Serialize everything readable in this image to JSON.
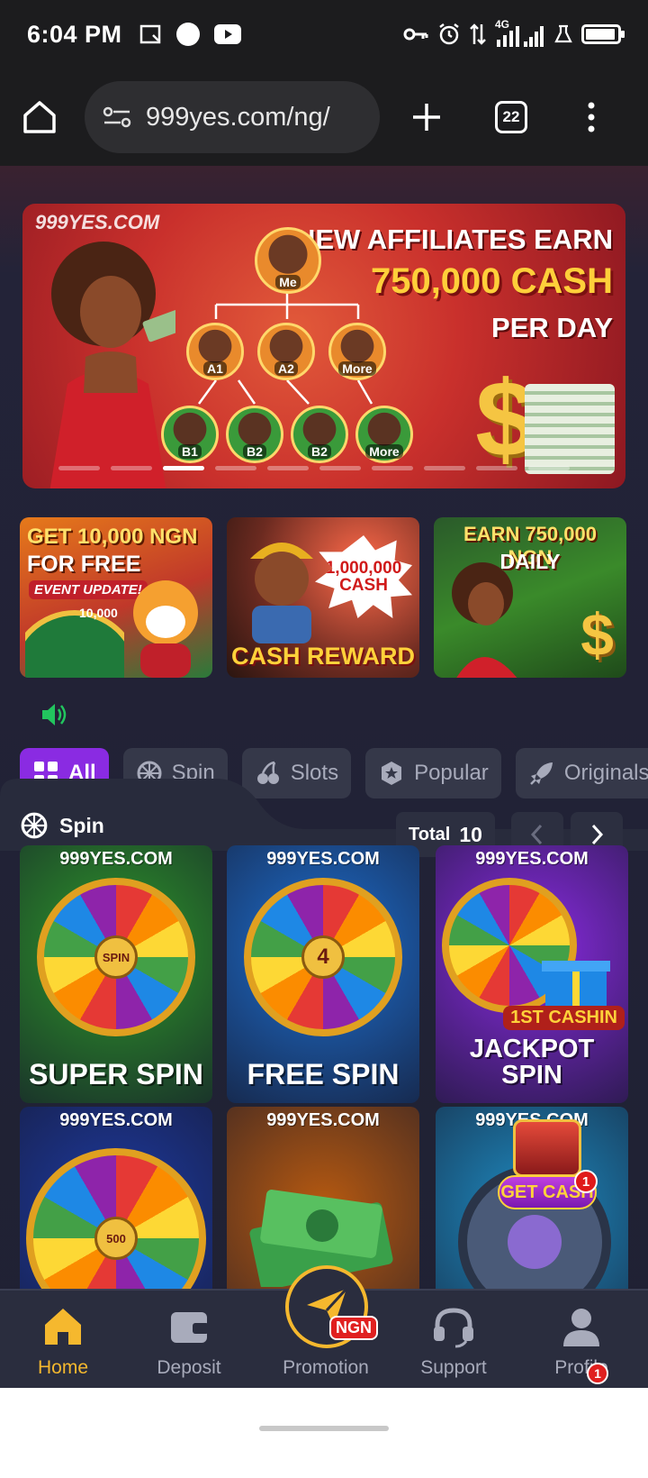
{
  "status_bar": {
    "time": "6:04 PM",
    "network_label": "4G",
    "icons": [
      "screenshot-icon",
      "record-dot-icon",
      "youtube-icon",
      "vpn-key-icon",
      "alarm-icon",
      "data-arrows-icon",
      "signal-icon",
      "lab-icon",
      "battery-icon"
    ],
    "battery_level": 0.95
  },
  "browser": {
    "url": "999yes.com/ng/",
    "tab_count": "22",
    "icons": [
      "home-icon",
      "site-settings-icon",
      "new-tab-icon",
      "tabs-icon",
      "menu-icon"
    ]
  },
  "hero": {
    "brand": "999YES.COM",
    "headline_1": "NEW AFFILIATES EARN",
    "headline_2": "750,000 CASH",
    "headline_3": "PER DAY",
    "tree": {
      "root": "Me",
      "level1": [
        "A1",
        "A2",
        "More"
      ],
      "level2": [
        "B1",
        "B2",
        "B2",
        "More"
      ]
    },
    "carousel_count": 10,
    "carousel_active": 3
  },
  "promos": [
    {
      "title_1": "GET 10,000 NGN",
      "title_2": "FOR FREE",
      "badge": "EVENT UPDATE!",
      "amount": "10,000"
    },
    {
      "burst": "1,000,000 CASH",
      "bottom": "CASH REWARD"
    },
    {
      "title_1": "EARN 750,000 NGN",
      "title_2": "DAILY"
    }
  ],
  "tabs": [
    {
      "label": "All",
      "icon": "grid-icon",
      "active": true
    },
    {
      "label": "Spin",
      "icon": "wheel-icon",
      "active": false
    },
    {
      "label": "Slots",
      "icon": "cherry-icon",
      "active": false
    },
    {
      "label": "Popular",
      "icon": "star-badge-icon",
      "active": false
    },
    {
      "label": "Originals",
      "icon": "rocket-icon",
      "active": false
    }
  ],
  "section": {
    "title": "Spin",
    "total_label": "Total",
    "total_value": "10"
  },
  "games": [
    {
      "brand": "999YES.COM",
      "title": "SUPER SPIN",
      "hub": "SPIN",
      "bg": "#2e9a2a"
    },
    {
      "brand": "999YES.COM",
      "title": "FREE SPIN",
      "hub": "4",
      "bg": "#1e6fd0"
    },
    {
      "brand": "999YES.COM",
      "title": "JACKPOT SPIN",
      "badge": "1ST CASHIN",
      "bg": "#8a2be2"
    },
    {
      "brand": "999YES.COM",
      "title": "",
      "hub": "500",
      "bg": "#1e3aa0"
    },
    {
      "brand": "999YES.COM",
      "title": "",
      "bg": "#b85a10"
    },
    {
      "brand": "999YES.COM",
      "title": "",
      "bg": "#1e8ac0"
    }
  ],
  "get_cash": {
    "label": "GET CASH",
    "count": "1"
  },
  "bottom_nav": [
    {
      "label": "Home",
      "icon": "home-icon",
      "active": true
    },
    {
      "label": "Deposit",
      "icon": "wallet-icon",
      "active": false
    },
    {
      "label": "Promotion",
      "icon": "paper-plane-icon",
      "active": false,
      "badge": "NGN"
    },
    {
      "label": "Support",
      "icon": "headset-icon",
      "active": false
    },
    {
      "label": "Profile",
      "icon": "user-icon",
      "active": false,
      "badge": "1"
    }
  ],
  "colors": {
    "accent_purple": "#8a2be2",
    "nav_active": "#f5b82e",
    "page_bg": "#1f2133",
    "tab_bg": "#353849"
  }
}
